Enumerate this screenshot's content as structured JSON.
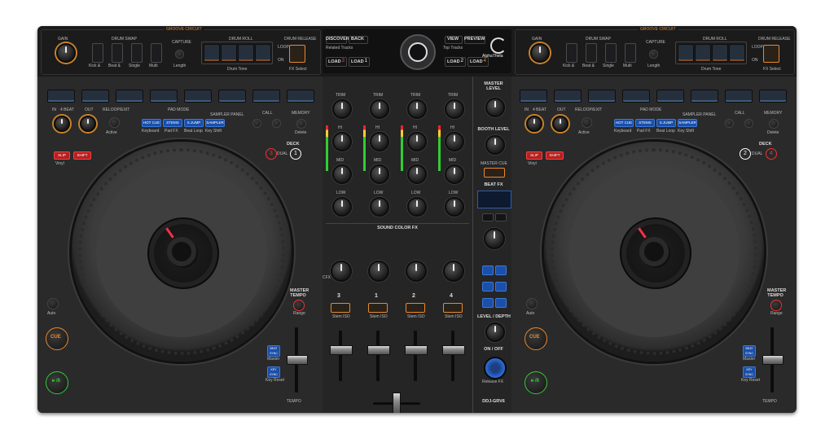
{
  "brand": "AlphaTheta",
  "model": "DDJ-GRV6",
  "colors": {
    "accent_orange": "#e8892b",
    "pad_blue": "#3d5b7c",
    "red": "#b62020",
    "body": "#2a2a2b"
  },
  "left_top": {
    "section": "GROOVE CIRCUIT",
    "gain": "GAIN",
    "drum_swap": "DRUM SWAP",
    "swap_labels": [
      "Kick &",
      "Beat &",
      "Single",
      "Multi"
    ],
    "capture": "CAPTURE",
    "length": "Length",
    "drum_roll": "DRUM ROLL",
    "drum_release": "DRUM RELEASE",
    "drum_tone": "Drum Tone",
    "fx_select": "FX Select",
    "loop_label": "LOOP",
    "on_label": "ON"
  },
  "right_top": {
    "section": "GROOVE CIRCUIT",
    "gain": "GAIN",
    "drum_swap": "DRUM SWAP",
    "swap_labels": [
      "Kick &",
      "Beat &",
      "Single",
      "Multi"
    ],
    "capture": "CAPTURE",
    "length": "Length",
    "drum_roll": "DRUM ROLL",
    "drum_release": "DRUM RELEASE",
    "drum_tone": "Drum Tone",
    "fx_select": "FX Select",
    "loop_label": "LOOP",
    "on_label": "ON"
  },
  "browser": {
    "discover": "DISCOVER",
    "back": "BACK",
    "related": "Related Tracks",
    "view": "VIEW",
    "preview": "PREVIEW",
    "top_tracks": "Top Tracks",
    "load_labels": [
      "LOAD",
      "LOAD",
      "LOAD",
      "LOAD"
    ],
    "load_nums": [
      "3",
      "1",
      "2",
      "4"
    ]
  },
  "left_deck": {
    "in": "IN",
    "beat": "4 BEAT",
    "out": "OUT",
    "reloop": "RELOOP/EXIT",
    "pad_mode": "PAD MODE",
    "sampler_panel": "SAMPLER PANEL",
    "pad_mode_buttons": [
      "HOT CUE",
      "STEMS",
      "S.JUMP",
      "SAMPLER"
    ],
    "pad_mode_sub": [
      "Keyboard",
      "Pad FX",
      "Beat Loop",
      "Key Shift"
    ],
    "call": "CALL",
    "memory": "MEMORY",
    "delete": "Delete",
    "slip": "SLIP",
    "shift": "SHIFT",
    "vinyl": "Vinyl",
    "deck": "DECK",
    "deck_numbers": [
      "3",
      "1"
    ],
    "dual": "DUAL",
    "auto": "Auto",
    "master_tempo": "MASTER TEMPO",
    "range": "Range",
    "cue": "CUE",
    "play": "►/II",
    "beat_sync": "BEAT SYNC",
    "master": "Master",
    "key_sync": "KEY SYNC",
    "key_reset": "Key Reset",
    "tempo": "TEMPO",
    "active": "Active"
  },
  "right_deck": {
    "in": "IN",
    "beat": "4 BEAT",
    "out": "OUT",
    "reloop": "RELOOP/EXIT",
    "pad_mode": "PAD MODE",
    "sampler_panel": "SAMPLER PANEL",
    "pad_mode_buttons": [
      "HOT CUE",
      "STEMS",
      "S.JUMP",
      "SAMPLER"
    ],
    "pad_mode_sub": [
      "Keyboard",
      "Pad FX",
      "Beat Loop",
      "Key Shift"
    ],
    "call": "CALL",
    "memory": "MEMORY",
    "delete": "Delete",
    "slip": "SLIP",
    "shift": "SHIFT",
    "vinyl": "Vinyl",
    "deck": "DECK",
    "deck_numbers": [
      "2",
      "4"
    ],
    "dual": "DUAL",
    "auto": "Auto",
    "master_tempo": "MASTER TEMPO",
    "range": "Range",
    "cue": "CUE",
    "play": "►/II",
    "beat_sync": "BEAT SYNC",
    "master": "Master",
    "key_sync": "KEY SYNC",
    "key_reset": "Key Reset",
    "tempo": "TEMPO",
    "active": "Active"
  },
  "mixer": {
    "trim": "TRIM",
    "hi": "HI",
    "mid": "MID",
    "low": "LOW",
    "sound_color_fx": "SOUND COLOR FX",
    "channels": [
      "3",
      "1",
      "2",
      "4"
    ],
    "stem_iso": "Stem ISO",
    "cfx": "CFX",
    "master_level": "MASTER LEVEL",
    "booth_level": "BOOTH LEVEL",
    "master_cue": "MASTER CUE",
    "beat_fx": "BEAT FX",
    "level_depth": "LEVEL / DEPTH",
    "on_off": "ON / OFF",
    "release_fx": "Release FX"
  }
}
